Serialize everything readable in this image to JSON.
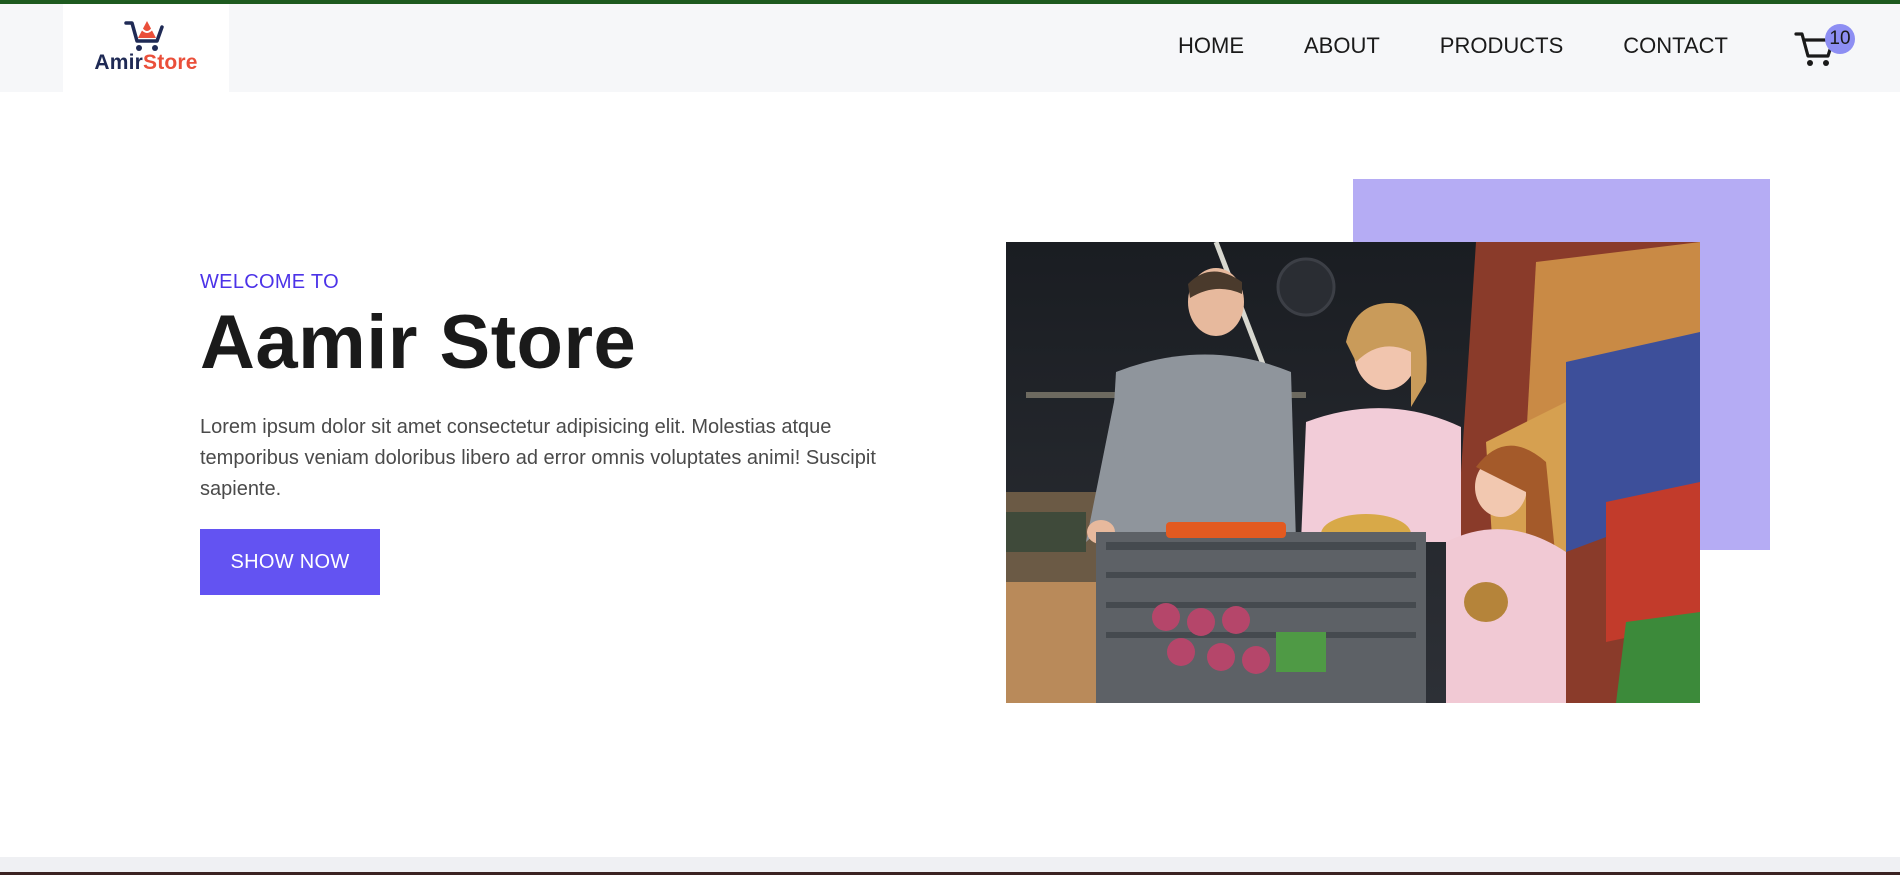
{
  "brand": {
    "name_part1": "Amir",
    "name_part2": "Store",
    "colors": {
      "navy": "#1f2a55",
      "red": "#ea4f3a"
    }
  },
  "nav": {
    "items": [
      {
        "label": "HOME"
      },
      {
        "label": "ABOUT"
      },
      {
        "label": "PRODUCTS"
      },
      {
        "label": "CONTACT"
      }
    ],
    "cart": {
      "icon": "shopping-cart-icon",
      "count": "10"
    }
  },
  "hero": {
    "eyebrow": "WELCOME TO",
    "title": "Aamir Store",
    "description": "Lorem ipsum dolor sit amet consectetur adipisicing elit. Molestias atque temporibus veniam doloribus libero ad error omnis voluptates animi! Suscipit sapiente.",
    "button_label": "SHOW NOW",
    "image_alt": "Family shopping in a supermarket with a cart"
  },
  "colors": {
    "accent": "#6353f2",
    "eyebrow": "#4c33e8",
    "accent_box": "#b5acf4",
    "top_stripe": "#1d5a1f"
  }
}
